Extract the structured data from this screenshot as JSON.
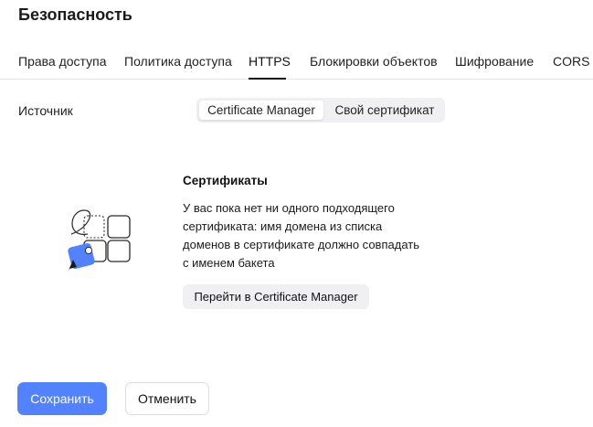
{
  "page": {
    "title": "Безопасность"
  },
  "tabs": [
    {
      "label": "Права доступа"
    },
    {
      "label": "Политика доступа"
    },
    {
      "label": "HTTPS",
      "active": true
    },
    {
      "label": "Блокировки объектов"
    },
    {
      "label": "Шифрование"
    },
    {
      "label": "CORS"
    }
  ],
  "source": {
    "label": "Источник",
    "options": [
      {
        "label": "Certificate Manager",
        "selected": true
      },
      {
        "label": "Свой сертификат",
        "selected": false
      }
    ]
  },
  "empty_state": {
    "title": "Сертификаты",
    "description_lines": [
      "У вас пока нет ни одного подходящего",
      "сертификата: имя домена из списка",
      "доменов в сертификате должно совпадать",
      "с именем бакета"
    ],
    "button_label": "Перейти в Certificate Manager",
    "illustration_icon": "certificate-illustration-icon"
  },
  "footer": {
    "save_label": "Сохранить",
    "cancel_label": "Отменить"
  },
  "colors": {
    "primary": "#5282ff",
    "segment_bg": "#f0f0f3",
    "illustration_accent": "#5282ff"
  }
}
